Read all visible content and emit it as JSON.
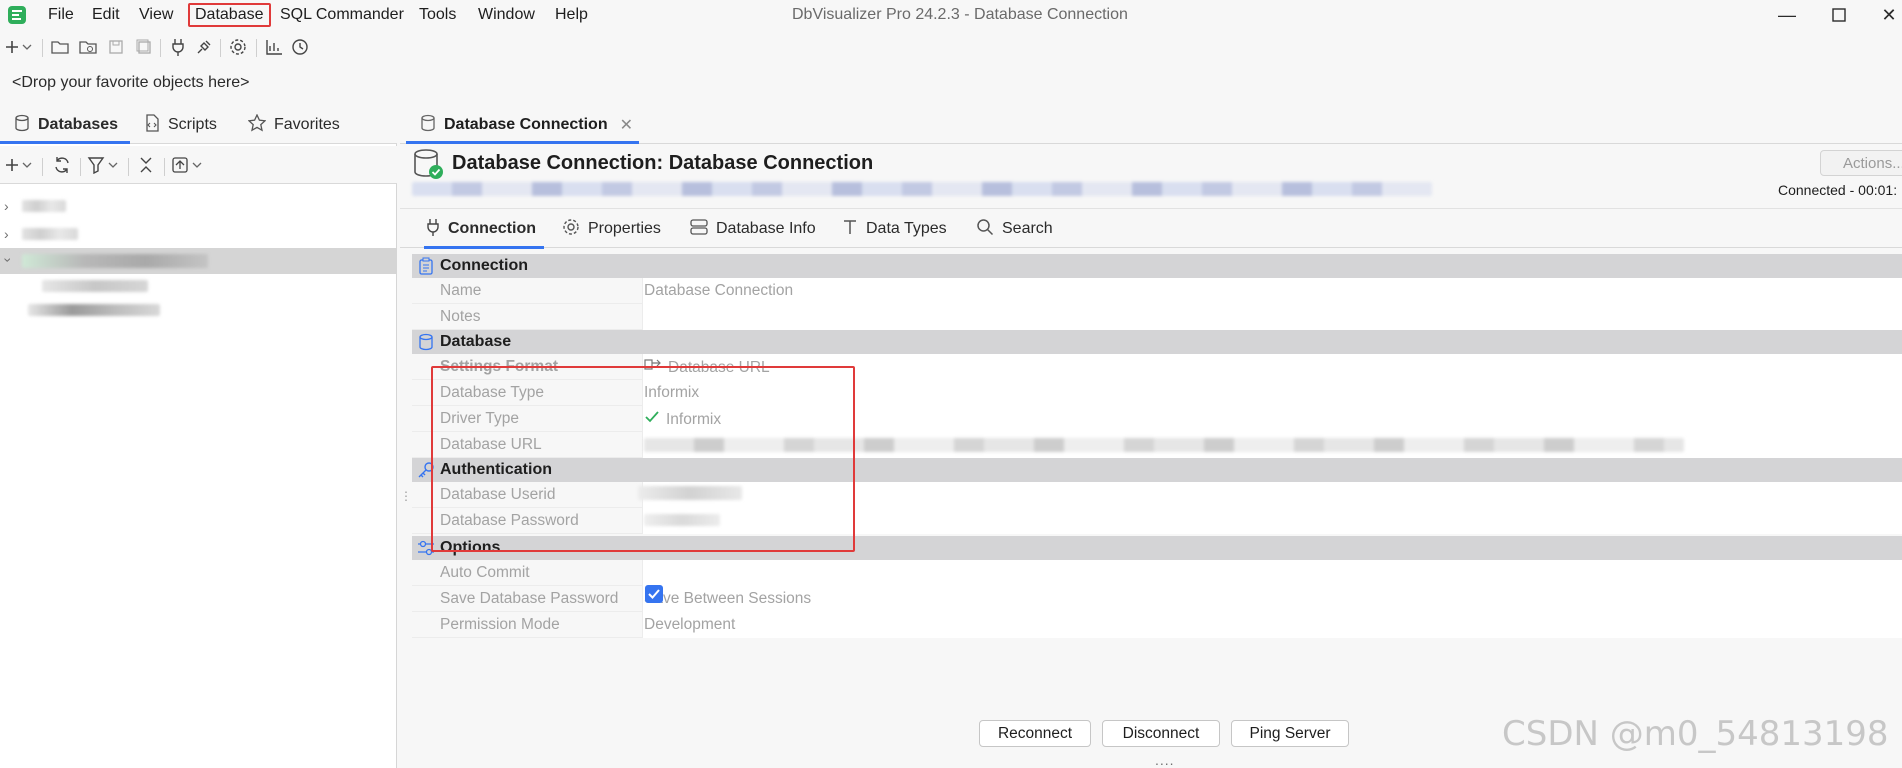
{
  "menubar": {
    "items": [
      "File",
      "Edit",
      "View",
      "Database",
      "SQL Commander",
      "Tools",
      "Window",
      "Help"
    ],
    "window_title": "DbVisualizer Pro 24.2.3 - Database Connection"
  },
  "favorites_bar": "<Drop your favorite objects here>",
  "left_tabs": [
    "Databases",
    "Scripts",
    "Favorites"
  ],
  "editor_tab": "Database Connection",
  "connection": {
    "title": "Database Connection: Database Connection",
    "actions_label": "Actions...",
    "status": "Connected - 00:01:"
  },
  "detail_tabs": [
    "Connection",
    "Properties",
    "Database Info",
    "Data Types",
    "Search"
  ],
  "sections": {
    "connection": {
      "header": "Connection",
      "rows": [
        {
          "label": "Name",
          "value": "Database Connection"
        },
        {
          "label": "Notes",
          "value": ""
        }
      ]
    },
    "database": {
      "header": "Database",
      "rows": [
        {
          "label": "Settings Format",
          "value": "Database URL"
        },
        {
          "label": "Database Type",
          "value": "Informix"
        },
        {
          "label": "Driver Type",
          "value": "Informix"
        },
        {
          "label": "Database URL",
          "value": ""
        }
      ]
    },
    "authentication": {
      "header": "Authentication",
      "rows": [
        {
          "label": "Database Userid",
          "value": ""
        },
        {
          "label": "Database Password",
          "value": ""
        }
      ]
    },
    "options": {
      "header": "Options",
      "rows": [
        {
          "label": "Auto Commit",
          "value": ""
        },
        {
          "label": "Save Database Password",
          "value": "Save Between Sessions"
        },
        {
          "label": "Permission Mode",
          "value": "Development"
        }
      ]
    }
  },
  "buttons": {
    "reconnect": "Reconnect",
    "disconnect": "Disconnect",
    "ping": "Ping Server"
  },
  "watermark": "CSDN @m0_54813198",
  "colors": {
    "accent": "#3574f0",
    "highlight": "#e03a3a",
    "connected_badge": "#2fae5b"
  }
}
